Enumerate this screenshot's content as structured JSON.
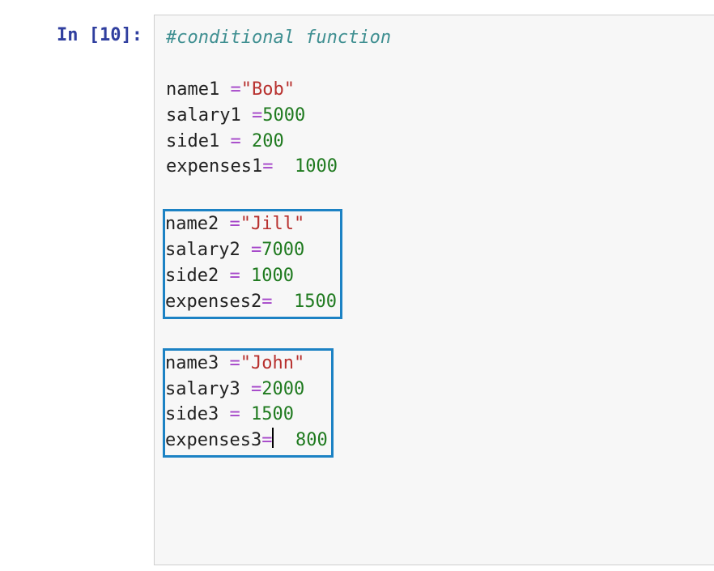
{
  "prompt": {
    "label": "In ",
    "open": "[",
    "num": "10",
    "close": "]:"
  },
  "code": {
    "comment": "#conditional function",
    "blocks": [
      {
        "highlighted": false,
        "lines": [
          {
            "id": "name1",
            "sp1": " ",
            "op": "=",
            "sp2": "",
            "strq": "\"",
            "str": "Bob",
            "num": null
          },
          {
            "id": "salary1",
            "sp1": " ",
            "op": "=",
            "sp2": "",
            "strq": null,
            "str": null,
            "num": "5000"
          },
          {
            "id": "side1",
            "sp1": " ",
            "op": "=",
            "sp2": " ",
            "strq": null,
            "str": null,
            "num": "200"
          },
          {
            "id": "expenses1",
            "sp1": "",
            "op": "=",
            "sp2": "  ",
            "strq": null,
            "str": null,
            "num": "1000"
          }
        ]
      },
      {
        "highlighted": true,
        "lines": [
          {
            "id": "name2",
            "sp1": " ",
            "op": "=",
            "sp2": "",
            "strq": "\"",
            "str": "Jill",
            "num": null
          },
          {
            "id": "salary2",
            "sp1": " ",
            "op": "=",
            "sp2": "",
            "strq": null,
            "str": null,
            "num": "7000"
          },
          {
            "id": "side2",
            "sp1": " ",
            "op": "=",
            "sp2": " ",
            "strq": null,
            "str": null,
            "num": "1000"
          },
          {
            "id": "expenses2",
            "sp1": "",
            "op": "=",
            "sp2": "  ",
            "strq": null,
            "str": null,
            "num": "1500"
          }
        ]
      },
      {
        "highlighted": true,
        "lines": [
          {
            "id": "name3",
            "sp1": " ",
            "op": "=",
            "sp2": "",
            "strq": "\"",
            "str": "John",
            "num": null
          },
          {
            "id": "salary3",
            "sp1": " ",
            "op": "=",
            "sp2": "",
            "strq": null,
            "str": null,
            "num": "2000"
          },
          {
            "id": "side3",
            "sp1": " ",
            "op": "=",
            "sp2": " ",
            "strq": null,
            "str": null,
            "num": "1500"
          },
          {
            "id": "expenses3",
            "sp1": "",
            "op": "=",
            "sp2": "  ",
            "strq": null,
            "str": null,
            "num": "800",
            "cursorAfterOp": true
          }
        ]
      }
    ]
  }
}
